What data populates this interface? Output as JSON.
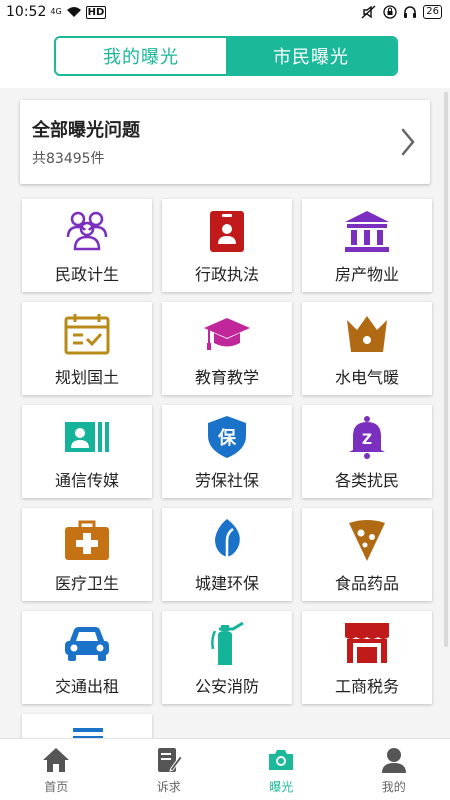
{
  "status_bar": {
    "time": "10:52",
    "net_top": "4G",
    "net_bottom": "ıl",
    "hd": "HD",
    "battery": "26"
  },
  "tabs": [
    {
      "label": "我的曝光",
      "active": false
    },
    {
      "label": "市民曝光",
      "active": true
    }
  ],
  "summary": {
    "title": "全部曝光问题",
    "count": "共83495件"
  },
  "categories": [
    {
      "label": "民政计生",
      "icon": "people-group-icon",
      "color": "#7b2fbe"
    },
    {
      "label": "行政执法",
      "icon": "id-badge-icon",
      "color": "#c01a1a"
    },
    {
      "label": "房产物业",
      "icon": "building-columns-icon",
      "color": "#7b2fbe"
    },
    {
      "label": "规划国土",
      "icon": "calendar-check-icon",
      "color": "#b88a18"
    },
    {
      "label": "教育教学",
      "icon": "graduation-cap-icon",
      "color": "#c0279a"
    },
    {
      "label": "水电气暖",
      "icon": "crown-icon",
      "color": "#b06a14"
    },
    {
      "label": "通信传媒",
      "icon": "contact-card-icon",
      "color": "#14b39a"
    },
    {
      "label": "劳保社保",
      "icon": "shield-bao-icon",
      "color": "#1a73c8"
    },
    {
      "label": "各类扰民",
      "icon": "bell-icon",
      "color": "#7b2fbe"
    },
    {
      "label": "医疗卫生",
      "icon": "medical-kit-icon",
      "color": "#c47214"
    },
    {
      "label": "城建环保",
      "icon": "leaf-icon",
      "color": "#1a73c8"
    },
    {
      "label": "食品药品",
      "icon": "pizza-slice-icon",
      "color": "#b06a14"
    },
    {
      "label": "交通出租",
      "icon": "car-icon",
      "color": "#1a73c8"
    },
    {
      "label": "公安消防",
      "icon": "fire-extinguisher-icon",
      "color": "#14b39a"
    },
    {
      "label": "工商税务",
      "icon": "storefront-icon",
      "color": "#c01a1a"
    }
  ],
  "bottom_nav": [
    {
      "label": "首页",
      "icon": "home-icon",
      "active": false
    },
    {
      "label": "诉求",
      "icon": "edit-note-icon",
      "active": false
    },
    {
      "label": "曝光",
      "icon": "camera-icon",
      "active": true
    },
    {
      "label": "我的",
      "icon": "user-icon",
      "active": false
    }
  ],
  "colors": {
    "accent": "#1bb89a",
    "inactive_nav": "#555555"
  }
}
